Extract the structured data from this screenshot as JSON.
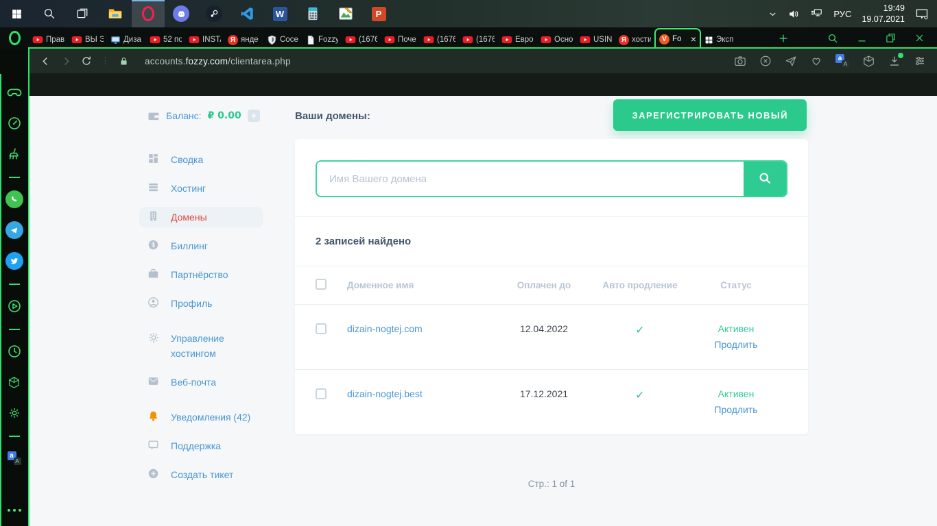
{
  "taskbar": {
    "apps": [
      {
        "name": "start"
      },
      {
        "name": "search"
      },
      {
        "name": "task-view"
      },
      {
        "name": "file-explorer"
      },
      {
        "name": "opera-gx",
        "active": true
      },
      {
        "name": "discord"
      },
      {
        "name": "steam"
      },
      {
        "name": "vscode"
      },
      {
        "name": "word"
      },
      {
        "name": "calculator"
      },
      {
        "name": "image-editor"
      },
      {
        "name": "powerpoint"
      }
    ],
    "tray": {
      "language": "РУС",
      "time": "19:49",
      "date": "19.07.2021"
    }
  },
  "tabbar": {
    "tabs": [
      {
        "favicon": "youtube",
        "label": "Прав"
      },
      {
        "favicon": "youtube",
        "label": "ВЫ Э"
      },
      {
        "favicon": "monitor",
        "label": "Диза"
      },
      {
        "favicon": "youtube",
        "label": "52 по"
      },
      {
        "favicon": "youtube",
        "label": "INSTA"
      },
      {
        "favicon": "yandex",
        "label": "янде"
      },
      {
        "favicon": "shield",
        "label": "Сосе"
      },
      {
        "favicon": "document",
        "label": "Fozzy"
      },
      {
        "favicon": "youtube",
        "label": "(1676"
      },
      {
        "favicon": "youtube",
        "label": "Поче"
      },
      {
        "favicon": "youtube",
        "label": "(1676"
      },
      {
        "favicon": "youtube",
        "label": "(1676"
      },
      {
        "favicon": "youtube",
        "label": "Евро"
      },
      {
        "favicon": "youtube",
        "label": "Осно"
      },
      {
        "favicon": "youtube",
        "label": "USIN"
      },
      {
        "favicon": "yandex",
        "label": "хости"
      },
      {
        "favicon": "fozzy",
        "label": "Fo",
        "active": true
      },
      {
        "favicon": "grid",
        "label": "Эксп"
      }
    ]
  },
  "addressbar": {
    "url_prefix": "accounts.",
    "url_host": "fozzy.com",
    "url_path": "/clientarea.php"
  },
  "gx_sidebar": {
    "icons": [
      "gamepad",
      "speedometer",
      "broom",
      "divider",
      "whatsapp",
      "telegram",
      "twitter",
      "divider",
      "play",
      "divider",
      "clock",
      "cube",
      "gear",
      "divider",
      "translate"
    ]
  },
  "page": {
    "balance": {
      "label": "Баланс:",
      "amount": "₽ 0.00"
    },
    "menu": {
      "items": [
        {
          "icon": "dashboard",
          "label": "Сводка"
        },
        {
          "icon": "list",
          "label": "Хостинг"
        },
        {
          "icon": "building",
          "label": "Домены",
          "active": true
        },
        {
          "icon": "coin",
          "label": "Биллинг"
        },
        {
          "icon": "briefcase",
          "label": "Партнёрство"
        },
        {
          "icon": "user",
          "label": "Профиль"
        },
        {
          "icon": "gear",
          "label": "Управление хостингом",
          "gap": true
        },
        {
          "icon": "envelope",
          "label": "Веб-почта"
        },
        {
          "icon": "bell",
          "label": "Уведомления (42)",
          "gap": true,
          "accent": true
        },
        {
          "icon": "chat",
          "label": "Поддержка"
        },
        {
          "icon": "plus-circle",
          "label": "Создать тикет"
        }
      ]
    },
    "header": {
      "title": "Ваши домены:",
      "register_button": "ЗАРЕГИСТРИРОВАТЬ НОВЫЙ"
    },
    "search": {
      "placeholder": "Имя Вашего домена"
    },
    "results_count": "2 записей найдено",
    "table": {
      "headers": [
        "Доменное имя",
        "Оплачен до",
        "Авто продление",
        "Статус"
      ],
      "rows": [
        {
          "domain": "dizain-nogtej.com",
          "paid_until": "12.04.2022",
          "auto_renew": "✓",
          "status": "Активен",
          "action": "Продлить"
        },
        {
          "domain": "dizain-nogtej.best",
          "paid_until": "17.12.2021",
          "auto_renew": "✓",
          "status": "Активен",
          "action": "Продлить"
        }
      ]
    },
    "pagination": "Стр.: 1 of 1"
  },
  "colors": {
    "accent_green": "#2bc98b",
    "gx_green": "#3fe671",
    "link_blue": "#4a96d2",
    "active_red": "#e04a3f"
  }
}
